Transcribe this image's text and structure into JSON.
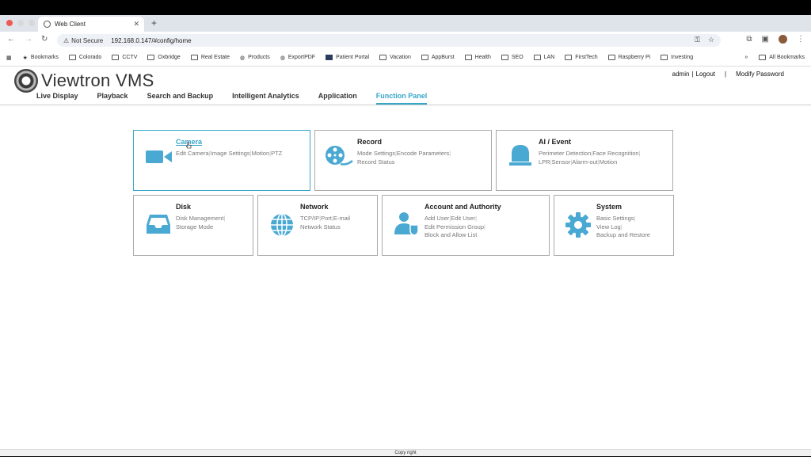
{
  "browser": {
    "tab_title": "Web Client",
    "url_security": "Not Secure",
    "url": "192.168.0.147/#config/home",
    "bookmarks": [
      "Bookmarks",
      "Colorado",
      "CCTV",
      "Oxbridge",
      "Real Estate",
      "Products",
      "ExportPDF",
      "Patient Portal",
      "Vacation",
      "AppBurst",
      "Health",
      "SEO",
      "LAN",
      "FirstTech",
      "Raspberry Pi",
      "Investing"
    ],
    "all_bookmarks": "All Bookmarks"
  },
  "app": {
    "title": "Viewtron VMS",
    "user": "admin",
    "logout": "Logout",
    "modify_password": "Modify Password",
    "menu": [
      "Live Display",
      "Playback",
      "Search and Backup",
      "Intelligent Analytics",
      "Application",
      "Function Panel"
    ],
    "active_menu": "Function Panel"
  },
  "panels": {
    "camera": {
      "title": "Camera",
      "links": [
        "Edit Camera",
        "Image Settings",
        "Motion",
        "PTZ"
      ]
    },
    "record": {
      "title": "Record",
      "links": [
        "Mode Settings",
        "Encode Parameters",
        "Record Status"
      ]
    },
    "ai": {
      "title": "AI / Event",
      "links": [
        "Perimeter Detection",
        "Face Recognition",
        "LPR",
        "Sensor",
        "Alarm-out",
        "Motion"
      ]
    },
    "disk": {
      "title": "Disk",
      "links": [
        "Disk Management",
        "Storage Mode"
      ]
    },
    "network": {
      "title": "Network",
      "links": [
        "TCP/IP",
        "Port",
        "E-mail",
        "Network Status"
      ]
    },
    "account": {
      "title": "Account and Authority",
      "links": [
        "Add User",
        "Edit User",
        "Edit Permission Group",
        "Block and Allow List"
      ]
    },
    "system": {
      "title": "System",
      "links": [
        "Basic Settings",
        "View Log",
        "Backup and Restore"
      ]
    }
  },
  "footer": "Copy right",
  "colors": {
    "accent": "#37a6c9",
    "icon": "#4aa9d2"
  }
}
